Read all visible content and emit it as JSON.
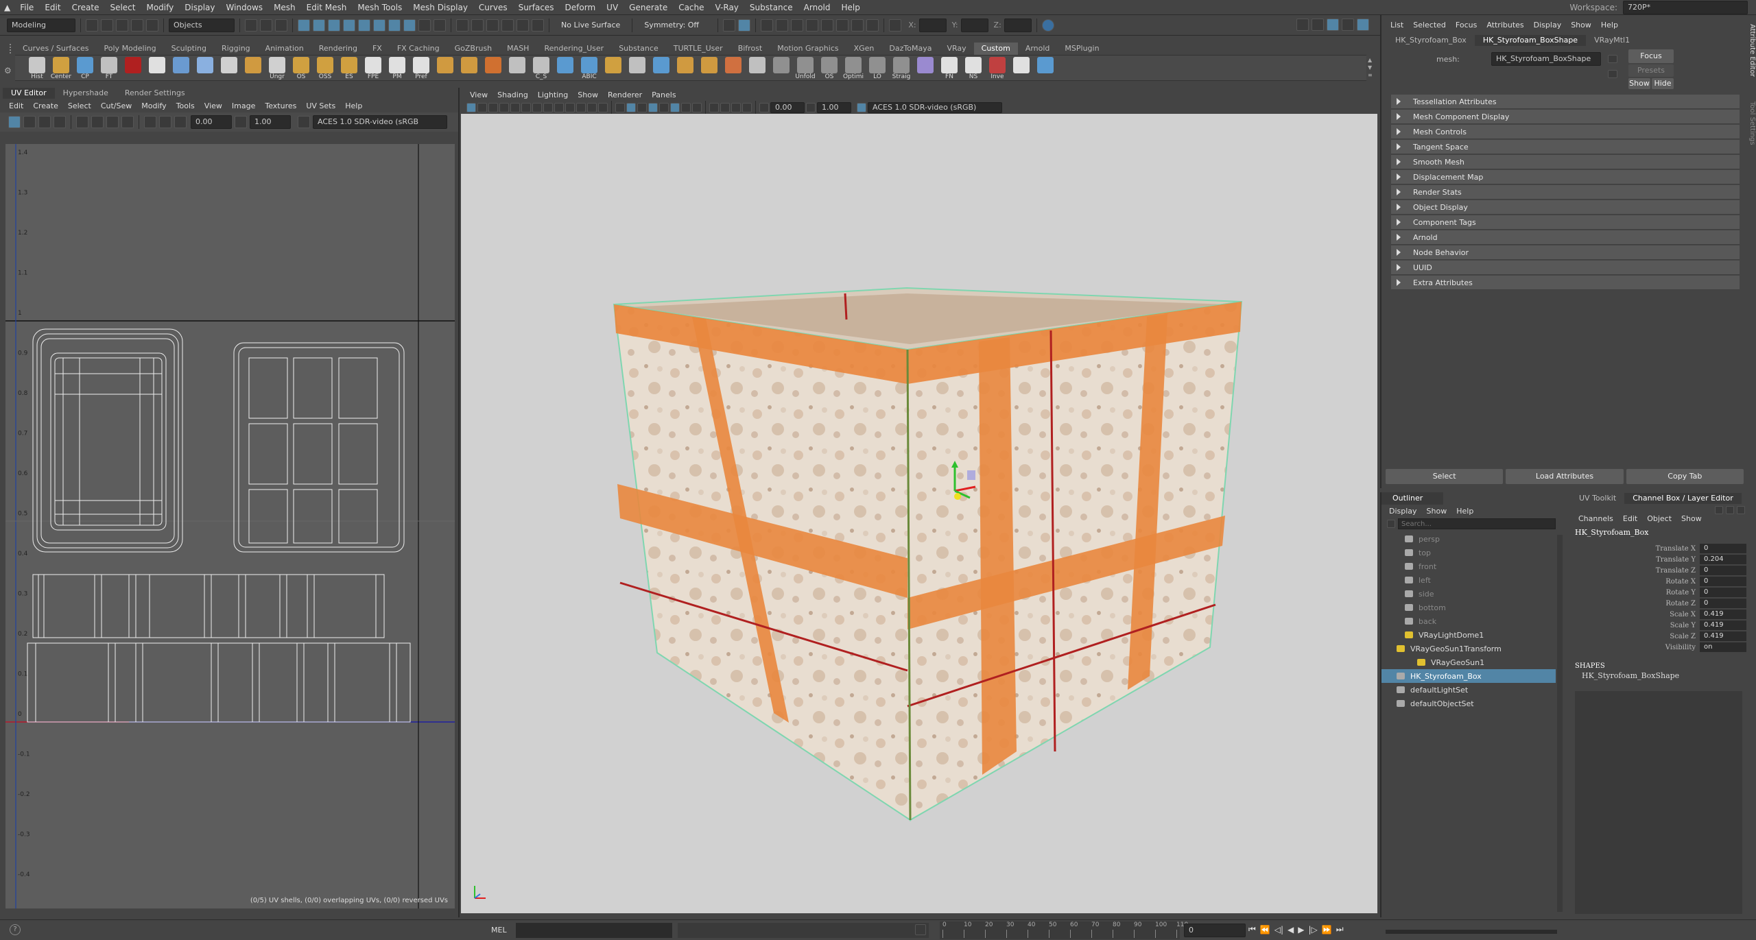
{
  "menubar": {
    "items": [
      "File",
      "Edit",
      "Create",
      "Select",
      "Modify",
      "Display",
      "Windows",
      "Mesh",
      "Edit Mesh",
      "Mesh Tools",
      "Mesh Display",
      "Curves",
      "Surfaces",
      "Deform",
      "UV",
      "Generate",
      "Cache",
      "V-Ray",
      "Substance",
      "Arnold",
      "Help"
    ],
    "workspace_label": "Workspace:",
    "workspace_value": "720P*"
  },
  "statusline": {
    "mode": "Modeling",
    "objects": "Objects",
    "live_surface": "No Live Surface",
    "symmetry": "Symmetry: Off",
    "x_label": "X:",
    "y_label": "Y:",
    "z_label": "Z:"
  },
  "shelf": {
    "tabs": [
      "Curves / Surfaces",
      "Poly Modeling",
      "Sculpting",
      "Rigging",
      "Animation",
      "Rendering",
      "FX",
      "FX Caching",
      "GoZBrush",
      "MASH",
      "Rendering_User",
      "Substance",
      "TURTLE_User",
      "Bifrost",
      "Motion Graphics",
      "XGen",
      "DazToMaya",
      "VRay",
      "Custom",
      "Arnold",
      "MSPlugin"
    ],
    "active": "Custom",
    "buttons": [
      {
        "label": "Hist",
        "color": "#c8c8c8"
      },
      {
        "label": "Center",
        "color": "#d0a040"
      },
      {
        "label": "CP",
        "color": "#5a9ad0"
      },
      {
        "label": "FT",
        "color": "#c0c0c0"
      },
      {
        "label": "",
        "color": "#b02020"
      },
      {
        "label": "",
        "color": "#e0e0e0"
      },
      {
        "label": "",
        "color": "#6a9ad0"
      },
      {
        "label": "",
        "color": "#8ab0e0"
      },
      {
        "label": "",
        "color": "#d0d0d0"
      },
      {
        "label": "",
        "color": "#d09a40"
      },
      {
        "label": "Ungr",
        "color": "#d0d0d0"
      },
      {
        "label": "OS",
        "color": "#d0a040"
      },
      {
        "label": "OSS",
        "color": "#d0a040"
      },
      {
        "label": "ES",
        "color": "#d0a040"
      },
      {
        "label": "FPE",
        "color": "#e0e0e0"
      },
      {
        "label": "PM",
        "color": "#e0e0e0"
      },
      {
        "label": "Pref",
        "color": "#e0e0e0"
      },
      {
        "label": "",
        "color": "#d09a40"
      },
      {
        "label": "",
        "color": "#d09a40"
      },
      {
        "label": "",
        "color": "#d07030"
      },
      {
        "label": "",
        "color": "#c0c0c0"
      },
      {
        "label": "C_S",
        "color": "#c0c0c0"
      },
      {
        "label": "",
        "color": "#5a9ad0"
      },
      {
        "label": "ABIC",
        "color": "#5a9ad0"
      },
      {
        "label": "",
        "color": "#d0a040"
      },
      {
        "label": "",
        "color": "#c0c0c0"
      },
      {
        "label": "",
        "color": "#5a9ad0"
      },
      {
        "label": "",
        "color": "#d09a40"
      },
      {
        "label": "",
        "color": "#d09a40"
      },
      {
        "label": "",
        "color": "#d07040"
      },
      {
        "label": "",
        "color": "#c0c0c0"
      },
      {
        "label": "",
        "color": "#909090"
      },
      {
        "label": "Unfold",
        "color": "#909090"
      },
      {
        "label": "OS",
        "color": "#909090"
      },
      {
        "label": "Optimi",
        "color": "#909090"
      },
      {
        "label": "LO",
        "color": "#909090"
      },
      {
        "label": "Straig",
        "color": "#909090"
      },
      {
        "label": "",
        "color": "#9a8ad0"
      },
      {
        "label": "FN",
        "color": "#e0e0e0"
      },
      {
        "label": "NS",
        "color": "#e0e0e0"
      },
      {
        "label": "Inve",
        "color": "#c04040"
      },
      {
        "label": "",
        "color": "#e0e0e0"
      },
      {
        "label": "",
        "color": "#5a9ad0"
      }
    ]
  },
  "uv_editor": {
    "tabs": [
      "UV Editor",
      "Hypershade",
      "Render Settings"
    ],
    "menu": [
      "Edit",
      "Create",
      "Select",
      "Cut/Sew",
      "Modify",
      "Tools",
      "View",
      "Image",
      "Textures",
      "UV Sets",
      "Help"
    ],
    "field1": "0.00",
    "field2": "1.00",
    "colorspace": "ACES 1.0 SDR-video (sRGB",
    "status": "(0/5) UV shells, (0/0) overlapping UVs, (0/0) reversed UVs",
    "ticks": [
      "1.4",
      "1.3",
      "1.2",
      "1.1",
      "1",
      "0.9",
      "0.8",
      "0.7",
      "0.6",
      "0.5",
      "0.4",
      "0.3",
      "0.2",
      "0.1",
      "0",
      "-0.1",
      "-0.2",
      "-0.3",
      "-0.4"
    ]
  },
  "viewport": {
    "menu": [
      "View",
      "Shading",
      "Lighting",
      "Show",
      "Renderer",
      "Panels"
    ],
    "field1": "0.00",
    "field2": "1.00",
    "colorspace": "ACES 1.0 SDR-video (sRGB)"
  },
  "attribute_editor": {
    "menu": [
      "List",
      "Selected",
      "Focus",
      "Attributes",
      "Display",
      "Show",
      "Help"
    ],
    "tabs": [
      "HK_Styrofoam_Box",
      "HK_Styrofoam_BoxShape",
      "VRayMtl1"
    ],
    "active_tab": "HK_Styrofoam_BoxShape",
    "mesh_label": "mesh:",
    "mesh_value": "HK_Styrofoam_BoxShape",
    "focus": "Focus",
    "presets": "Presets",
    "show": "Show",
    "hide": "Hide",
    "sections": [
      "Tessellation Attributes",
      "Mesh Component Display",
      "Mesh Controls",
      "Tangent Space",
      "Smooth Mesh",
      "Displacement Map",
      "Render Stats",
      "Object Display",
      "Component Tags",
      "Arnold",
      "Node Behavior",
      "UUID",
      "Extra Attributes"
    ],
    "select_btn": "Select",
    "load_btn": "Load Attributes",
    "copy_btn": "Copy Tab",
    "side_tabs": [
      "Attribute Editor",
      "Tool Settings"
    ]
  },
  "outliner": {
    "title": "Outliner",
    "menu": [
      "Display",
      "Show",
      "Help"
    ],
    "search_placeholder": "Search...",
    "items": [
      {
        "label": "persp",
        "dim": true
      },
      {
        "label": "top",
        "dim": true
      },
      {
        "label": "front",
        "dim": true
      },
      {
        "label": "left",
        "dim": true
      },
      {
        "label": "side",
        "dim": true
      },
      {
        "label": "bottom",
        "dim": true
      },
      {
        "label": "back",
        "dim": true
      },
      {
        "label": "VRayLightDome1",
        "dim": false
      },
      {
        "label": "VRayGeoSun1Transform",
        "dim": false
      },
      {
        "label": "VRayGeoSun1",
        "dim": false
      },
      {
        "label": "HK_Styrofoam_Box",
        "dim": false,
        "selected": true
      },
      {
        "label": "defaultLightSet",
        "dim": false
      },
      {
        "label": "defaultObjectSet",
        "dim": false
      }
    ]
  },
  "channel_box": {
    "tabs": [
      "UV Toolkit",
      "Channel Box / Layer Editor"
    ],
    "menu": [
      "Channels",
      "Edit",
      "Object",
      "Show"
    ],
    "object": "HK_Styrofoam_Box",
    "channels": [
      {
        "name": "Translate X",
        "value": "0"
      },
      {
        "name": "Translate Y",
        "value": "0.204"
      },
      {
        "name": "Translate Z",
        "value": "0"
      },
      {
        "name": "Rotate X",
        "value": "0"
      },
      {
        "name": "Rotate Y",
        "value": "0"
      },
      {
        "name": "Rotate Z",
        "value": "0"
      },
      {
        "name": "Scale X",
        "value": "0.419"
      },
      {
        "name": "Scale Y",
        "value": "0.419"
      },
      {
        "name": "Scale Z",
        "value": "0.419"
      },
      {
        "name": "Visibility",
        "value": "on"
      }
    ],
    "shapes_title": "SHAPES",
    "shape": "HK_Styrofoam_BoxShape"
  },
  "timebar": {
    "mel": "MEL",
    "ticks": [
      "0",
      "10",
      "20",
      "30",
      "40",
      "50",
      "60",
      "70",
      "80",
      "90",
      "100",
      "110"
    ],
    "current_frame": "0"
  }
}
